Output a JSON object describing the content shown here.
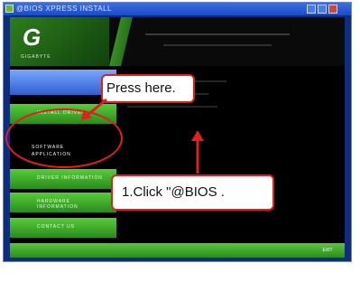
{
  "window": {
    "title": "@BIOS XPRESS INSTALL",
    "icon": "app-icon"
  },
  "header": {
    "logo_word": "GIGABYTE"
  },
  "nav": {
    "items": [
      {
        "label": "INSTALL DRIVER"
      },
      {
        "label": "SOFTWARE\nAPPLICATION"
      },
      {
        "label": "DRIVER INFORMATION"
      },
      {
        "label": "HARDWARE\nINFORMATION"
      },
      {
        "label": "CONTACT US"
      }
    ]
  },
  "footer": {
    "exit_label": "EXIT"
  },
  "annotations": {
    "press_here": "Press here.",
    "click_step": "1.Click \"@BIOS ."
  },
  "colors": {
    "accent_green": "#4caf2f",
    "callout_red": "#e02020",
    "window_blue": "#1a4bc5"
  }
}
